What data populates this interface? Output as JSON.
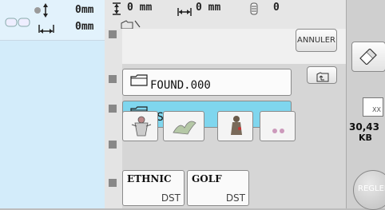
{
  "left_panel": {
    "dim_height": "0mm",
    "dim_width": "0mm"
  },
  "top_bar": {
    "height_value": "0 mm",
    "width_value": "0 mm",
    "stitch_value": "0"
  },
  "toolbar": {
    "cancel_label": "ANNULER",
    "set_label": "REGLER"
  },
  "folders": [
    {
      "label": "FOUND.000",
      "selected": false
    },
    {
      "label": "DST_PA~1",
      "selected": true
    }
  ],
  "designs": [
    {
      "name": "ETHNIC",
      "format": "DST"
    },
    {
      "name": "GOLF",
      "format": "DST"
    }
  ],
  "memory": {
    "value": "30,43",
    "unit": "KB",
    "chip_label": "XX"
  }
}
